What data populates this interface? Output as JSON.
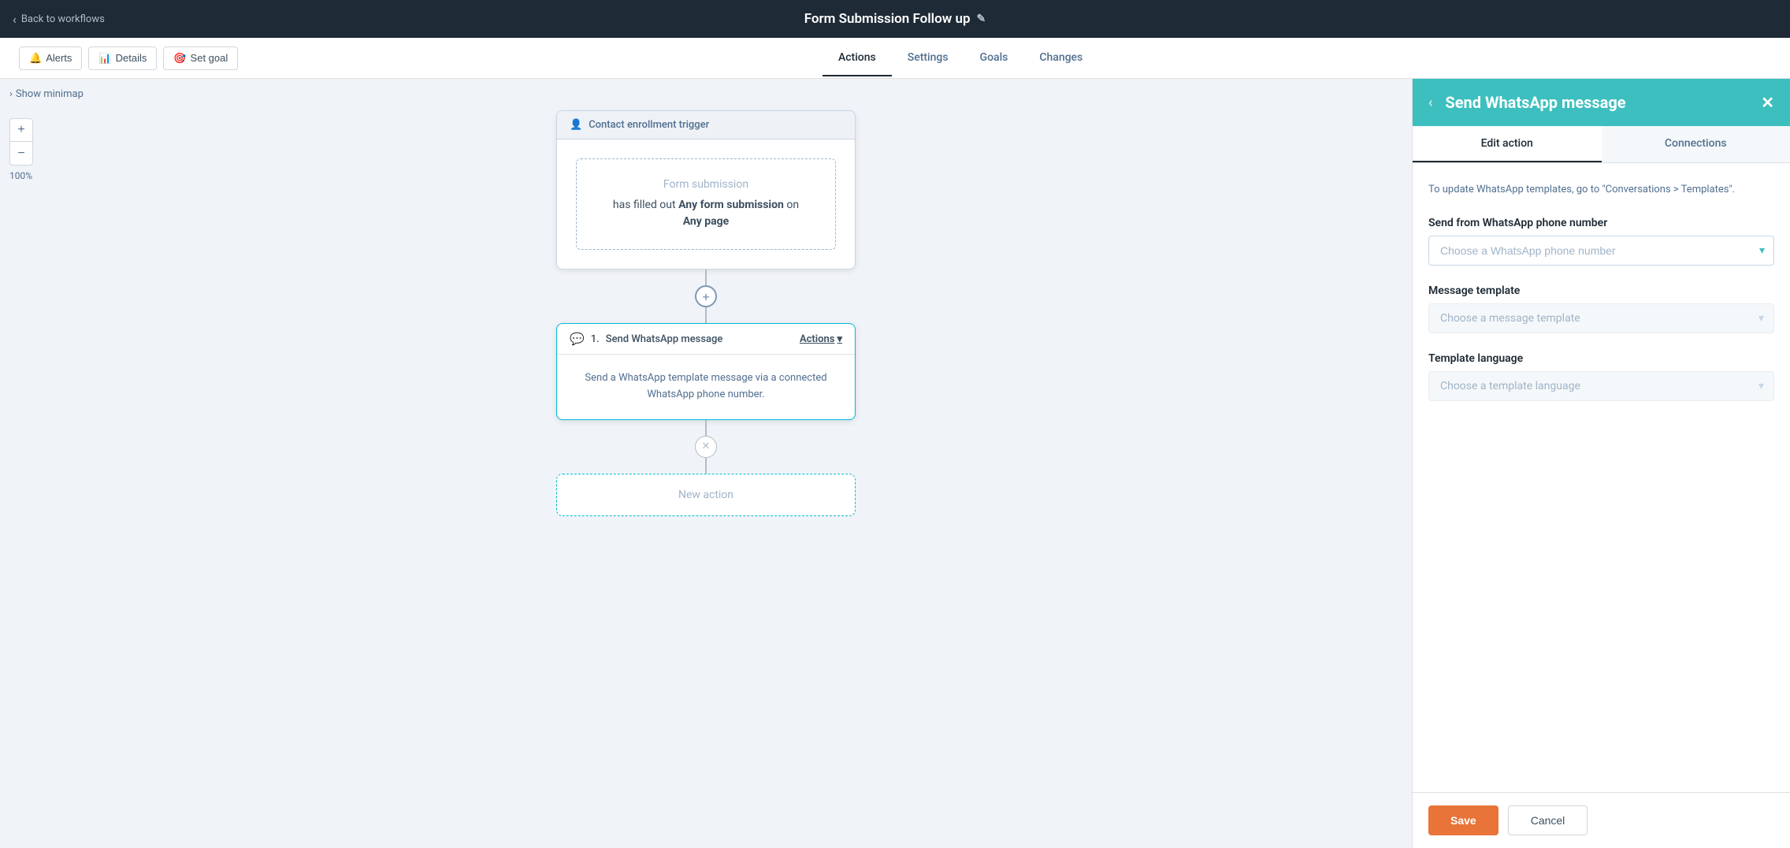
{
  "topNav": {
    "backLabel": "Back to workflows",
    "workflowTitle": "Form Submission Follow up",
    "editIconLabel": "✎"
  },
  "subNav": {
    "alertsLabel": "Alerts",
    "detailsLabel": "Details",
    "setGoalLabel": "Set goal",
    "tabs": [
      {
        "id": "actions",
        "label": "Actions",
        "active": true
      },
      {
        "id": "settings",
        "label": "Settings",
        "active": false
      },
      {
        "id": "goals",
        "label": "Goals",
        "active": false
      },
      {
        "id": "changes",
        "label": "Changes",
        "active": false
      }
    ]
  },
  "canvas": {
    "minimapLabel": "Show minimap",
    "zoomInLabel": "+",
    "zoomOutLabel": "−",
    "zoomLevel": "100%",
    "triggerNode": {
      "header": "Contact enrollment trigger",
      "triggerType": "Form submission",
      "description": "has filled out",
      "boldPart1": "Any form submission",
      "on": "on",
      "boldPart2": "Any page"
    },
    "actionNode": {
      "stepNumber": "1.",
      "title": "Send WhatsApp message",
      "actionsLabel": "Actions",
      "description": "Send a WhatsApp template message via a connected WhatsApp phone number."
    },
    "newActionLabel": "New action"
  },
  "rightPanel": {
    "title": "Send WhatsApp message",
    "backLabel": "‹",
    "closeLabel": "✕",
    "tabs": [
      {
        "id": "edit",
        "label": "Edit action",
        "active": true
      },
      {
        "id": "connections",
        "label": "Connections",
        "active": false
      }
    ],
    "infoText": "To update WhatsApp templates, go to \"Conversations > Templates\".",
    "phoneNumberField": {
      "label": "Send from WhatsApp phone number",
      "placeholder": "Choose a WhatsApp phone number",
      "options": []
    },
    "messageTemplateField": {
      "label": "Message template",
      "placeholder": "Choose a message template",
      "options": [],
      "disabled": true
    },
    "templateLanguageField": {
      "label": "Template language",
      "placeholder": "Choose a template language",
      "options": [],
      "disabled": true
    },
    "saveLabel": "Save",
    "cancelLabel": "Cancel"
  }
}
